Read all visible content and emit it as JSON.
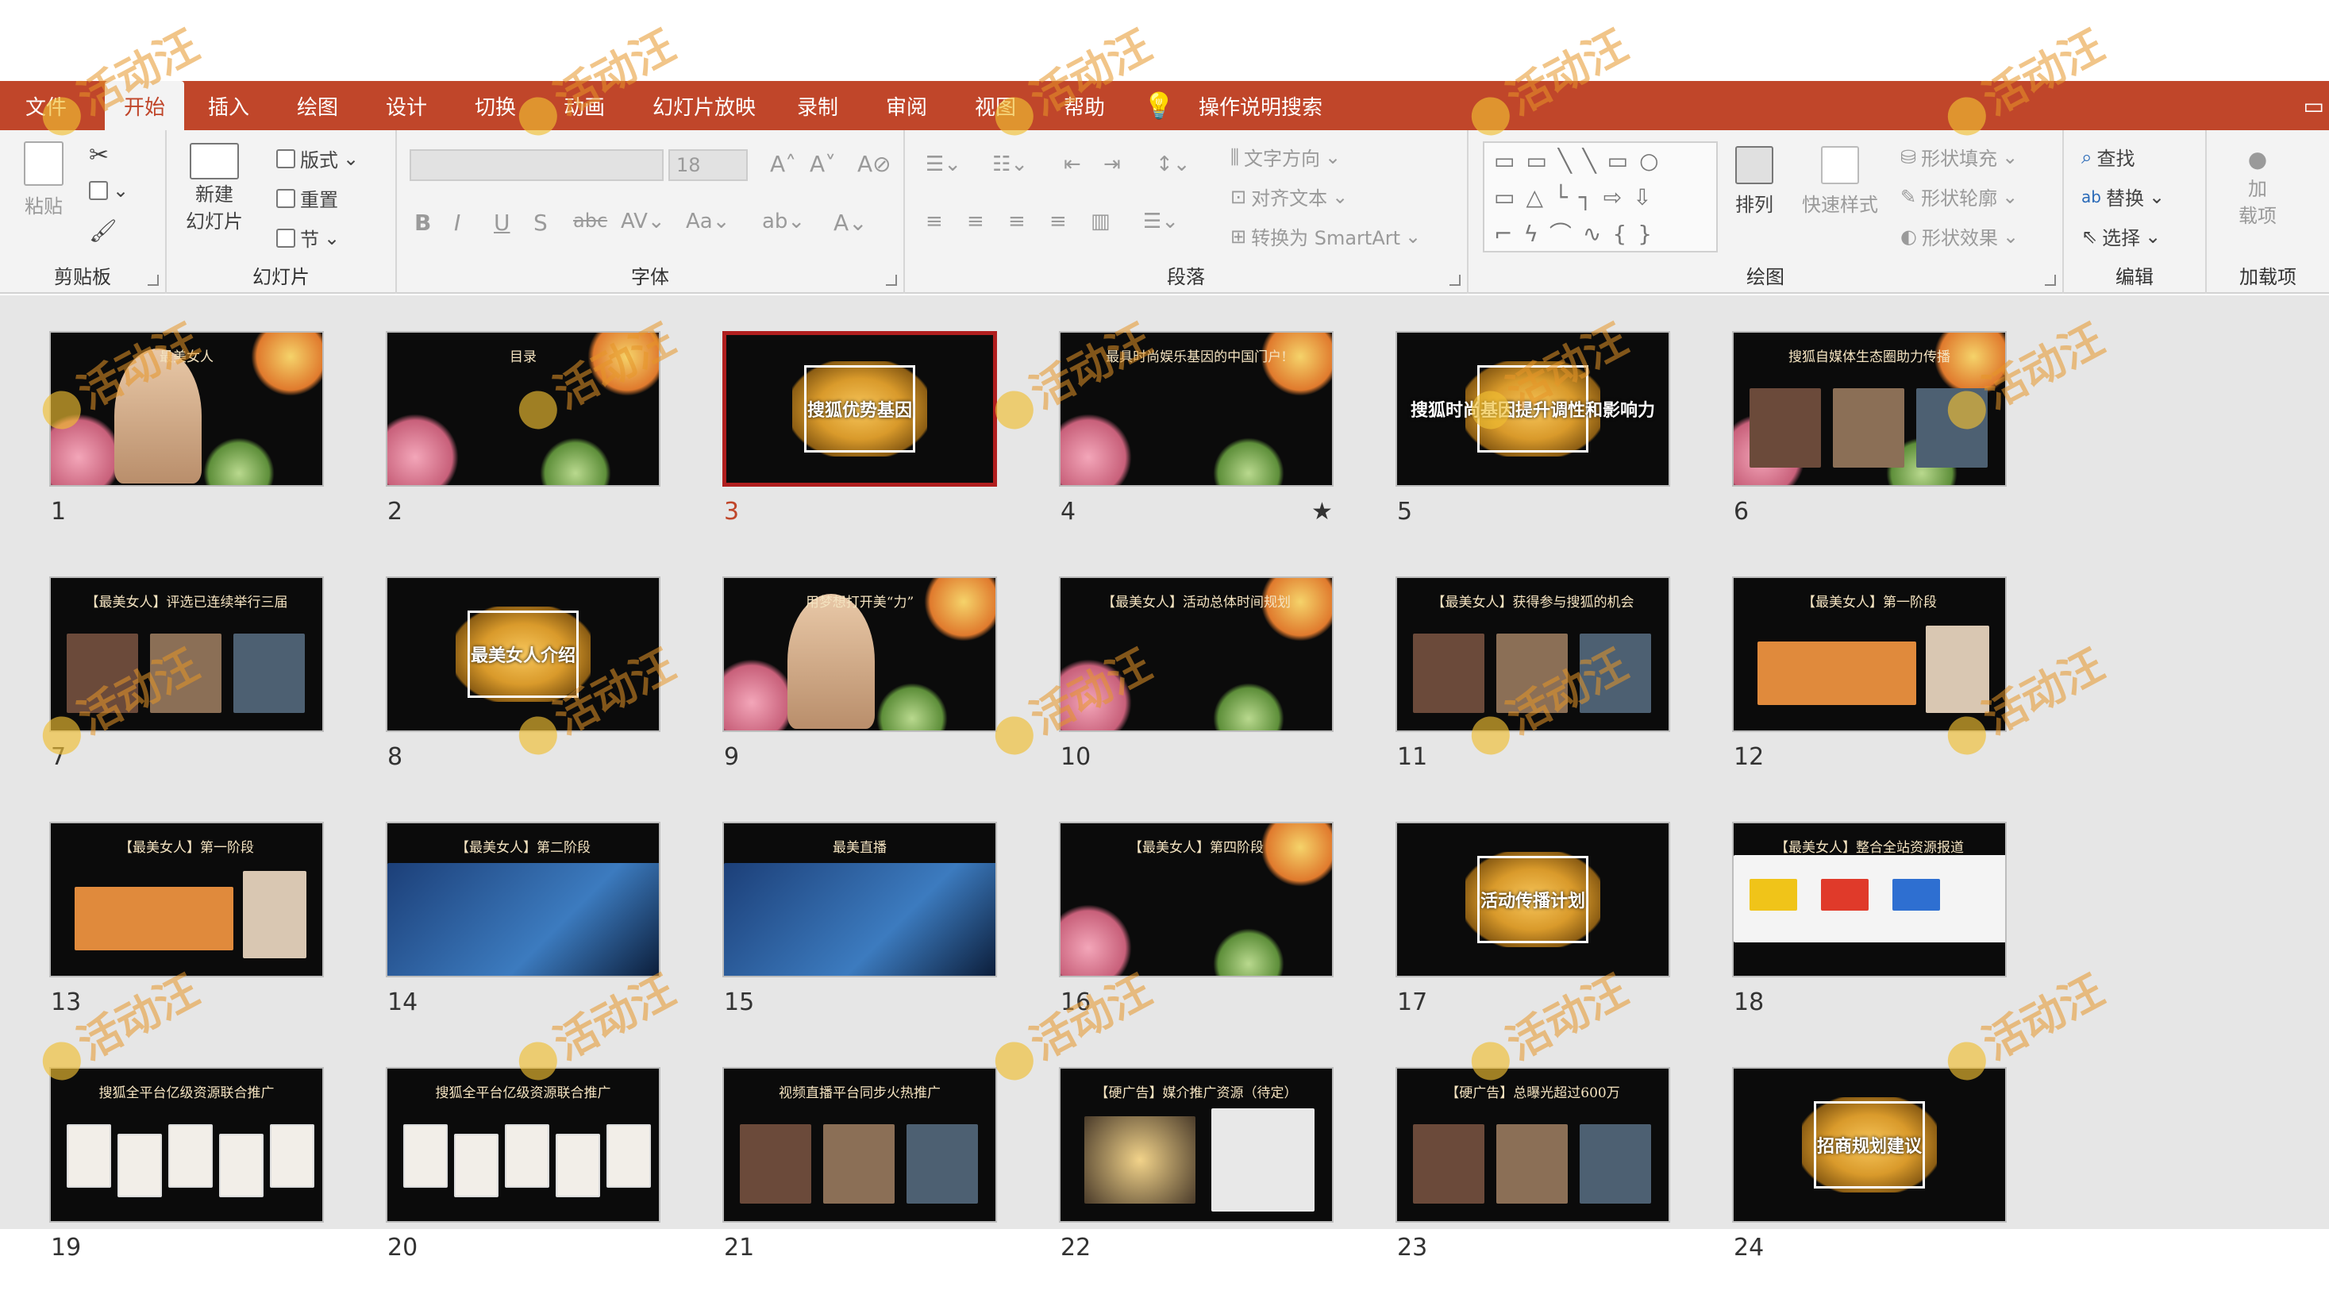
{
  "menu": {
    "tabs": [
      "文件",
      "开始",
      "插入",
      "绘图",
      "设计",
      "切换",
      "动画",
      "幻灯片放映",
      "录制",
      "审阅",
      "视图",
      "帮助"
    ],
    "active_tab": "开始",
    "search_label": "操作说明搜索"
  },
  "ribbon": {
    "clipboard": {
      "label": "剪贴板",
      "paste": "粘贴"
    },
    "slides": {
      "label": "幻灯片",
      "new_slide_line1": "新建",
      "new_slide_line2": "幻灯片",
      "layout": "版式",
      "reset": "重置",
      "section": "节"
    },
    "font": {
      "label": "字体",
      "font_size": "18"
    },
    "paragraph": {
      "label": "段落",
      "text_direction": "文字方向",
      "align_text": "对齐文本",
      "convert_smartart": "转换为 SmartArt"
    },
    "drawing": {
      "label": "绘图",
      "arrange": "排列",
      "quick_styles": "快速样式",
      "shape_fill": "形状填充",
      "shape_outline": "形状轮廓",
      "shape_effects": "形状效果"
    },
    "editing": {
      "label": "编辑",
      "find": "查找",
      "replace": "替换",
      "select": "选择"
    },
    "addins": {
      "label": "加载项",
      "addins_line1": "加",
      "addins_line2": "载项"
    }
  },
  "watermark_text": "活动汪",
  "slides": [
    {
      "num": "1",
      "title": "最美女人",
      "style": "portrait"
    },
    {
      "num": "2",
      "title": "目录",
      "style": "flowers"
    },
    {
      "num": "3",
      "title": "搜狐优势基因",
      "style": "gold",
      "selected": true
    },
    {
      "num": "4",
      "title": "最具时尚娱乐基因的中国门户!",
      "style": "flowers",
      "star": true
    },
    {
      "num": "5",
      "title": "搜狐时尚基因提升调性和影响力",
      "style": "gold"
    },
    {
      "num": "6",
      "title": "搜狐自媒体生态圈助力传播",
      "style": "collage"
    },
    {
      "num": "7",
      "title": "【最美女人】评选已连续举行三届",
      "style": "photos"
    },
    {
      "num": "8",
      "title": "最美女人介绍",
      "style": "gold"
    },
    {
      "num": "9",
      "title": "用梦想打开美“力”",
      "style": "portrait"
    },
    {
      "num": "10",
      "title": "【最美女人】活动总体时间规划",
      "style": "flowers"
    },
    {
      "num": "11",
      "title": "【最美女人】获得参与搜狐的机会",
      "style": "photos"
    },
    {
      "num": "12",
      "title": "【最美女人】第一阶段",
      "style": "orange"
    },
    {
      "num": "13",
      "title": "【最美女人】第一阶段",
      "style": "orange"
    },
    {
      "num": "14",
      "title": "【最美女人】第二阶段",
      "style": "blue"
    },
    {
      "num": "15",
      "title": "最美直播",
      "style": "blue"
    },
    {
      "num": "16",
      "title": "【最美女人】第四阶段",
      "style": "flowers"
    },
    {
      "num": "17",
      "title": "活动传播计划",
      "style": "gold"
    },
    {
      "num": "18",
      "title": "【最美女人】整合全站资源报道",
      "style": "logos"
    },
    {
      "num": "19",
      "title": "搜狐全平台亿级资源联合推广",
      "style": "screens"
    },
    {
      "num": "20",
      "title": "搜狐全平台亿级资源联合推广",
      "style": "screens"
    },
    {
      "num": "21",
      "title": "视频直播平台同步火热推广",
      "style": "photos"
    },
    {
      "num": "22",
      "title": "【硬广告】媒介推广资源（待定）",
      "style": "dark"
    },
    {
      "num": "23",
      "title": "【硬广告】总曝光超过600万",
      "style": "photos"
    },
    {
      "num": "24",
      "title": "招商规划建议",
      "style": "gold"
    }
  ],
  "colors": {
    "accent": "#c0462a",
    "ribbon_bg": "#f3f3f3",
    "sorter_bg": "#e6e6e6",
    "selected_border": "#b01e1e"
  }
}
